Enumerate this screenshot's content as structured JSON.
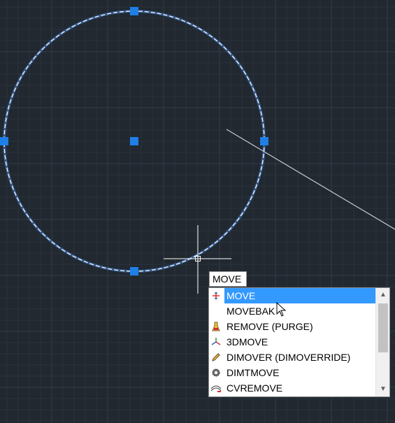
{
  "command_input": {
    "value": "MOVE"
  },
  "autocomplete": {
    "items": [
      {
        "label": "MOVE",
        "icon": "move-icon",
        "selected": true
      },
      {
        "label": "MOVEBAK",
        "icon": "none",
        "selected": false
      },
      {
        "label": "REMOVE (PURGE)",
        "icon": "purge-icon",
        "selected": false
      },
      {
        "label": "3DMOVE",
        "icon": "3dmove-icon",
        "selected": false
      },
      {
        "label": "DIMOVER (DIMOVERRIDE)",
        "icon": "pencil-icon",
        "selected": false
      },
      {
        "label": "DIMTMOVE",
        "icon": "gear-icon",
        "selected": false
      },
      {
        "label": "CVREMOVE",
        "icon": "cvremove-icon",
        "selected": false
      }
    ]
  },
  "colors": {
    "background": "#212830",
    "grip": "#1e7fe6",
    "selection": "#3399ff"
  }
}
